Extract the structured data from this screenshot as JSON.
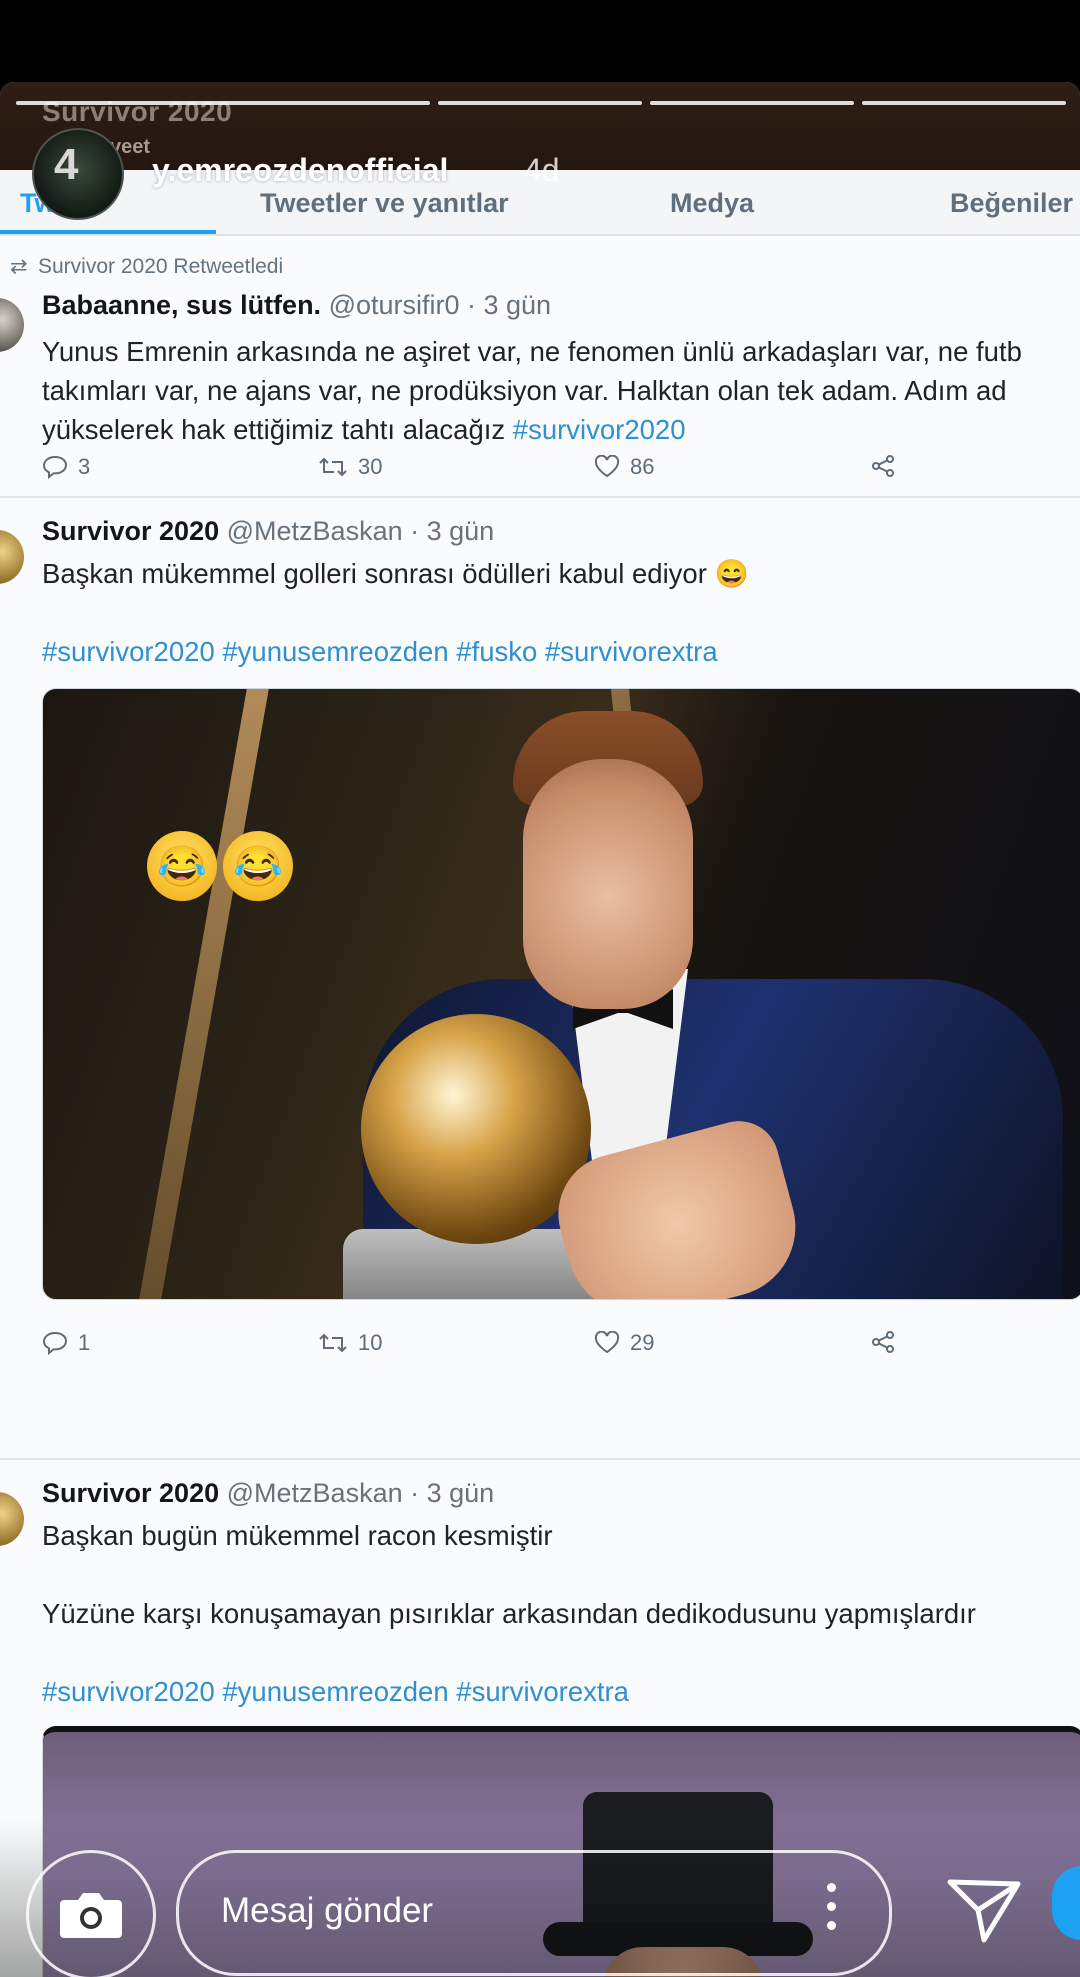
{
  "story": {
    "username": "y.emreozdenofficial",
    "time_ago": "4d",
    "avatar_glyph": "4",
    "segments": 5,
    "active_segment_index": 4
  },
  "twitter": {
    "ghost_title": "Survivor 2020",
    "ghost_subtitle": "veet",
    "tabs": [
      {
        "label": "Tweet",
        "active": true
      },
      {
        "label": "Tweetler ve yanıtlar",
        "active": false
      },
      {
        "label": "Medya",
        "active": false
      },
      {
        "label": "Beğeniler",
        "active": false
      }
    ],
    "tweets": [
      {
        "retweet_label": "Survivor 2020 Retweetledi",
        "author": "Babaanne, sus lütfen.",
        "handle_time": "@otursifir0 · 3 gün",
        "lines": [
          "Yunus Emrenin arkasında ne aşiret var, ne fenomen ünlü arkadaşları var, ne futb",
          "takımları var, ne ajans var, ne prodüksiyon var. Halktan olan tek adam. Adım ad"
        ],
        "last_line_text": "yükselerek hak ettiğimiz tahtı alacağız ",
        "last_line_hashtag": "#survivor2020",
        "replies": "3",
        "retweets": "30",
        "likes": "86"
      },
      {
        "author": "Survivor 2020",
        "handle_time": "@MetzBaskan · 3 gün",
        "text": "Başkan mükemmel golleri sonrası ödülleri kabul ediyor 😄",
        "hashtags": "#survivor2020 #yunusemreozden #fusko #survivorextra",
        "media_emoji": "😂😂",
        "replies": "1",
        "retweets": "10",
        "likes": "29"
      },
      {
        "author": "Survivor 2020",
        "handle_time": "@MetzBaskan · 3 gün",
        "line1": "Başkan bugün mükemmel racon kesmiştir",
        "line2": "Yüzüne karşı konuşamayan pısırıklar arkasından dedikodusunu yapmışlardır",
        "hashtags": "#survivor2020 #yunusemreozden #survivorextra"
      }
    ]
  },
  "composer": {
    "placeholder": "Mesaj gönder"
  },
  "colors": {
    "twitter_blue": "#1da1f2",
    "hashtag": "#2f8fd0"
  }
}
